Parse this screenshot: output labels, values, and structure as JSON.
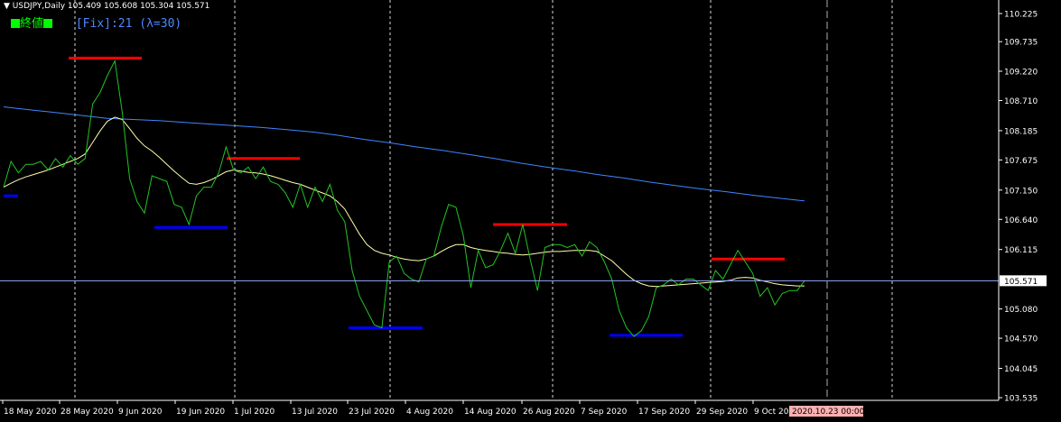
{
  "header": {
    "symbol": "USDJPY,Daily",
    "ohlc": "105.409 105.608 105.304 105.571",
    "indicator_name": "終値",
    "indicator_params": "[Fix]:21 (λ=30)"
  },
  "colors": {
    "background": "#000000",
    "price_line": "#22c422",
    "ma_fast": "#ffffaa",
    "ma_slow": "#3f86ff",
    "resistance": "#ff0000",
    "support": "#0000ff",
    "grid_vertical": "#ffffff",
    "current_price_line": "#8fa8ff",
    "current_price_box": "#ffffff",
    "time_tag_box": "#ffb0b0"
  },
  "chart_data": {
    "type": "line",
    "ylim": [
      103.535,
      110.3
    ],
    "y_ticks": [
      "110.225",
      "109.735",
      "109.220",
      "108.710",
      "108.185",
      "107.675",
      "107.150",
      "106.640",
      "106.115",
      "105.571",
      "105.080",
      "104.570",
      "104.045",
      "103.535"
    ],
    "x_ticks": [
      "18 May 2020",
      "28 May 2020",
      "9 Jun 2020",
      "19 Jun 2020",
      "1 Jul 2020",
      "13 Jul 2020",
      "23 Jul 2020",
      "4 Aug 2020",
      "14 Aug 2020",
      "26 Aug 2020",
      "7 Sep 2020",
      "17 Sep 2020",
      "29 Sep 2020",
      "9 Oct 202"
    ],
    "time_tag": "2020.10.23 00:00",
    "current_price": 105.571,
    "series": [
      {
        "key": "close",
        "values": [
          107.2,
          107.65,
          107.45,
          107.6,
          107.6,
          107.65,
          107.5,
          107.7,
          107.55,
          107.75,
          107.6,
          107.7,
          108.65,
          108.85,
          109.15,
          109.4,
          108.5,
          107.35,
          106.95,
          106.75,
          107.4,
          107.35,
          107.3,
          106.9,
          106.85,
          106.55,
          107.05,
          107.2,
          107.2,
          107.45,
          107.9,
          107.5,
          107.45,
          107.55,
          107.35,
          107.55,
          107.3,
          107.25,
          107.1,
          106.85,
          107.25,
          106.85,
          107.2,
          106.95,
          107.25,
          106.8,
          106.6,
          105.75,
          105.3,
          105.05,
          104.8,
          104.75,
          105.9,
          106.0,
          105.7,
          105.6,
          105.55,
          105.95,
          106.0,
          106.5,
          106.9,
          106.85,
          106.35,
          105.45,
          106.1,
          105.8,
          105.85,
          106.1,
          106.4,
          106.05,
          106.55,
          105.95,
          105.4,
          106.15,
          106.2,
          106.2,
          106.15,
          106.2,
          106.0,
          106.25,
          106.15,
          105.9,
          105.6,
          105.05,
          104.75,
          104.6,
          104.7,
          104.95,
          105.45,
          105.5,
          105.6,
          105.5,
          105.6,
          105.6,
          105.5,
          105.4,
          105.75,
          105.6,
          105.85,
          106.1,
          105.9,
          105.7,
          105.3,
          105.45,
          105.15,
          105.35,
          105.4,
          105.4,
          105.571
        ]
      },
      {
        "key": "ma_fast",
        "values": [
          107.2,
          107.27,
          107.33,
          107.38,
          107.42,
          107.46,
          107.5,
          107.55,
          107.6,
          107.65,
          107.7,
          107.78,
          107.98,
          108.18,
          108.35,
          108.42,
          108.38,
          108.22,
          108.05,
          107.92,
          107.83,
          107.72,
          107.6,
          107.48,
          107.37,
          107.27,
          107.25,
          107.28,
          107.33,
          107.4,
          107.47,
          107.5,
          107.48,
          107.46,
          107.45,
          107.43,
          107.4,
          107.36,
          107.32,
          107.28,
          107.25,
          107.2,
          107.15,
          107.1,
          107.05,
          106.95,
          106.82,
          106.6,
          106.38,
          106.2,
          106.1,
          106.05,
          106.02,
          105.98,
          105.95,
          105.93,
          105.92,
          105.95,
          106.0,
          106.08,
          106.15,
          106.2,
          106.2,
          106.15,
          106.12,
          106.1,
          106.08,
          106.06,
          106.05,
          106.03,
          106.02,
          106.03,
          106.05,
          106.07,
          106.08,
          106.08,
          106.09,
          106.1,
          106.1,
          106.1,
          106.08,
          106.0,
          105.92,
          105.8,
          105.68,
          105.58,
          105.52,
          105.48,
          105.47,
          105.48,
          105.49,
          105.5,
          105.51,
          105.52,
          105.53,
          105.54,
          105.55,
          105.56,
          105.58,
          105.62,
          105.63,
          105.62,
          105.58,
          105.55,
          105.52,
          105.5,
          105.49,
          105.48,
          105.48
        ]
      },
      {
        "key": "ma_slow",
        "values": [
          108.6,
          108.55,
          108.5,
          108.45,
          108.4,
          108.38,
          108.36,
          108.33,
          108.3,
          108.27,
          108.24,
          108.2,
          108.16,
          108.1,
          108.03,
          107.97,
          107.9,
          107.84,
          107.77,
          107.7,
          107.62,
          107.55,
          107.49,
          107.42,
          107.36,
          107.29,
          107.23,
          107.17,
          107.12,
          107.06,
          107.01,
          106.96
        ]
      }
    ],
    "resistance_levels": [
      109.45,
      107.7,
      106.55,
      105.95
    ],
    "support_levels": [
      107.05,
      106.5,
      104.75,
      104.62
    ]
  }
}
